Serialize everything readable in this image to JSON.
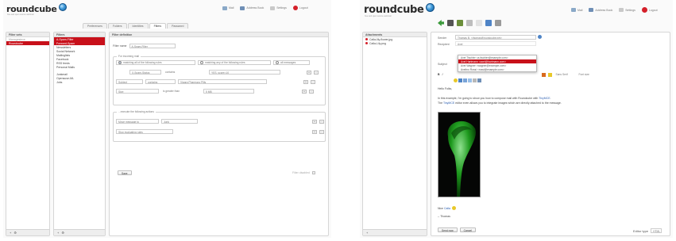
{
  "left": {
    "logo": {
      "word": "roundcube",
      "sub": "free and open source webmail"
    },
    "topmenu": [
      "Mail",
      "Address Book",
      "Settings",
      "Logout"
    ],
    "tabs": [
      "Preferences",
      "Folders",
      "Identities",
      "Filters",
      "Password"
    ],
    "filter_sets": {
      "header": "Filter sets",
      "items": [
        "Managesieve",
        "Roundcube"
      ]
    },
    "filters": {
      "header": "Filters",
      "items": [
        "A-Spam-Filter",
        "Forward-Spam",
        "Newsletters",
        "Social Network",
        "Mailinglists",
        "Facebook",
        "RSS feeds",
        "Personal Mails",
        "Junkmail",
        "Opensuse-ML",
        "Jobs"
      ]
    },
    "form": {
      "header": "Filter definition",
      "name_label": "Filter name",
      "name_value": "A-Spam-Filter",
      "rules_legend": "For incoming mail",
      "match_options": [
        "matching all of the following rules",
        "matching any of the following rules",
        "all messages"
      ],
      "rule_rows": [
        {
          "header": "X-Spam-Status",
          "op": "contains",
          "value": "YES, score=10"
        },
        {
          "header": "Subject",
          "op": "contains",
          "value": "Viagra Pharmacy Pills"
        },
        {
          "header": "Size",
          "op": "is greater than",
          "value": "5 MB"
        }
      ],
      "actions_legend": "...execute the following actions",
      "action_rows": [
        {
          "action": "Move message to",
          "target": "Junk"
        },
        {
          "action": "Stop evaluating rules",
          "target": ""
        }
      ],
      "plus": "+",
      "minus": "-",
      "save": "Save",
      "disable_label": "Filter disabled"
    },
    "footer": {
      "add": "+",
      "gear": "⚙"
    }
  },
  "right": {
    "logo": {
      "word": "roundcube",
      "sub": "free and open source webmail"
    },
    "topmenu": [
      "Mail",
      "Address Book",
      "Settings",
      "Logout"
    ],
    "attachments": {
      "header": "Attachments",
      "items": [
        "Calla-lily-flower.jpg",
        "Calla-Lily.png"
      ]
    },
    "compose": {
      "sender_label": "Sender",
      "sender_value": "Thomas B. <thomas@roundcube.net>",
      "recipient_label": "Recipient",
      "recipient_value": "Axel",
      "subject_label": "Subject",
      "suggestions": [
        "Axel Tischler <a.tischler@example.com>",
        "Axel Hartmann <axel@hartmann.com>",
        "Axel Wagner <wagner@example.com>",
        "Axelino Rossi <rossi@example.com>"
      ],
      "font_family": "Sans Serif",
      "font_size": "Font size",
      "greeting": "Hello Folks,",
      "body_line1_prefix": "In this example, I'm going to show you how to compose mail with Roundcube with ",
      "body_link": "TinyMCE",
      "body_line1_suffix": ".",
      "body_line2_prefix": "The ",
      "body_line2_link": "TinyMCE",
      "body_line2_suffix": " editor even allows you to integrate images which are directly attached to the message.",
      "caption_prefix": "Nice ",
      "caption_link": "Calla",
      "signature": "-- Thomas",
      "send": "Send now",
      "cancel": "Cancel",
      "editor_type_label": "Editor type",
      "editor_type_value": "HTML"
    },
    "footer": {
      "add": "+"
    }
  },
  "colors": {
    "selection": "#c8101a",
    "logo_blue": "#3d98d8",
    "link": "#2a5db0",
    "leaf_green": "#1e9a1e"
  }
}
